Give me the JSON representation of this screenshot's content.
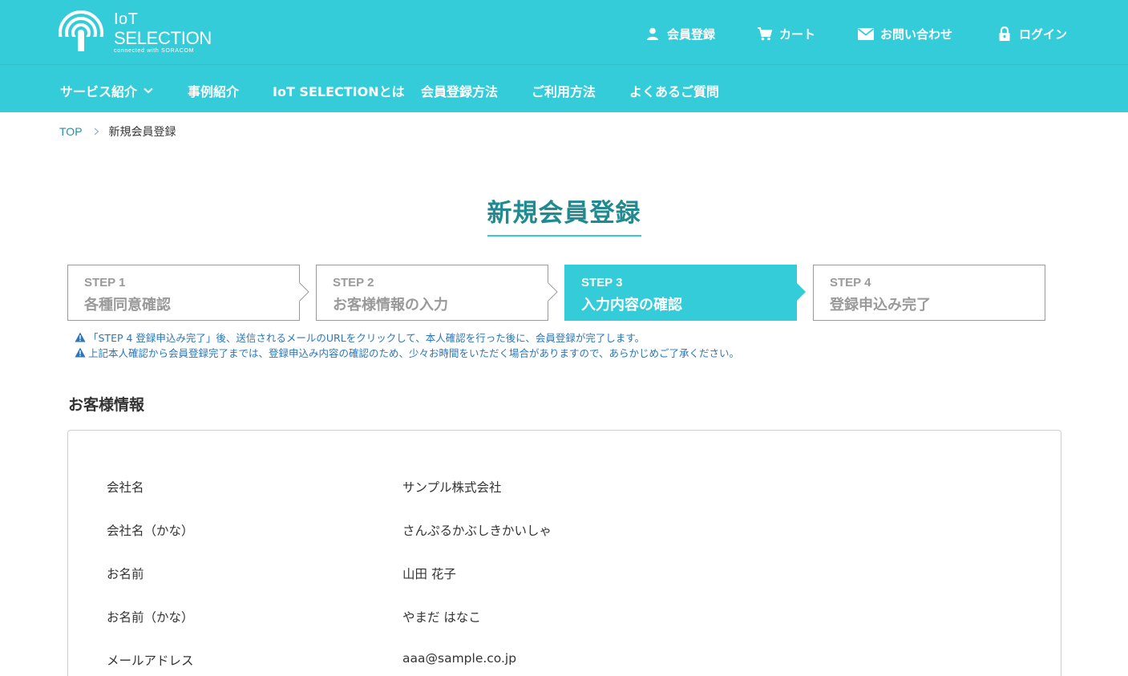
{
  "brand": {
    "name_line1": "IoT",
    "name_line2": "SELECTION",
    "tagline": "connected with SORACOM",
    "color": "#34ccd9"
  },
  "utility_nav": [
    {
      "label": "会員登録",
      "icon": "user-icon"
    },
    {
      "label": "カート",
      "icon": "cart-icon"
    },
    {
      "label": "お問い合わせ",
      "icon": "mail-icon"
    },
    {
      "label": "ログイン",
      "icon": "lock-icon"
    }
  ],
  "main_nav": [
    {
      "label": "サービス紹介",
      "icon": "chevron-down-icon"
    },
    {
      "label": "事例紹介"
    },
    {
      "label": "IoT SELECTIONとは"
    },
    {
      "label": "会員登録方法"
    },
    {
      "label": "ご利用方法"
    },
    {
      "label": "よくあるご質問"
    }
  ],
  "breadcrumb": {
    "home": "TOP",
    "current": "新規会員登録"
  },
  "page_title": "新規会員登録",
  "steps": [
    {
      "num": "STEP 1",
      "label": "各種同意確認",
      "active": false
    },
    {
      "num": "STEP 2",
      "label": "お客様情報の入力",
      "active": false
    },
    {
      "num": "STEP 3",
      "label": "入力内容の確認",
      "active": true
    },
    {
      "num": "STEP 4",
      "label": "登録申込み完了",
      "active": false
    }
  ],
  "notices": [
    "「STEP 4 登録申込み完了」後、送信されるメールのURLをクリックして、本人確認を行った後に、会員登録が完了します。",
    "上記本人確認から会員登録完了までは、登録申込み内容の確認のため、少々お時間をいただく場合がありますので、あらかじめご了承ください。"
  ],
  "section_title": "お客様情報",
  "customer_info": [
    {
      "label": "会社名",
      "value": "サンプル株式会社"
    },
    {
      "label": "会社名（かな）",
      "value": "さんぷるかぶしきかいしゃ"
    },
    {
      "label": "お名前",
      "value": "山田 花子"
    },
    {
      "label": "お名前（かな）",
      "value": "やまだ はなこ"
    },
    {
      "label": "メールアドレス",
      "value": "aaa@sample.co.jp"
    }
  ],
  "colors": {
    "accent": "#34ccd9",
    "title": "#1f8a8f",
    "link": "#2a8fa6",
    "notice": "#2a76b8",
    "step_inactive": "#9a9a9a"
  }
}
